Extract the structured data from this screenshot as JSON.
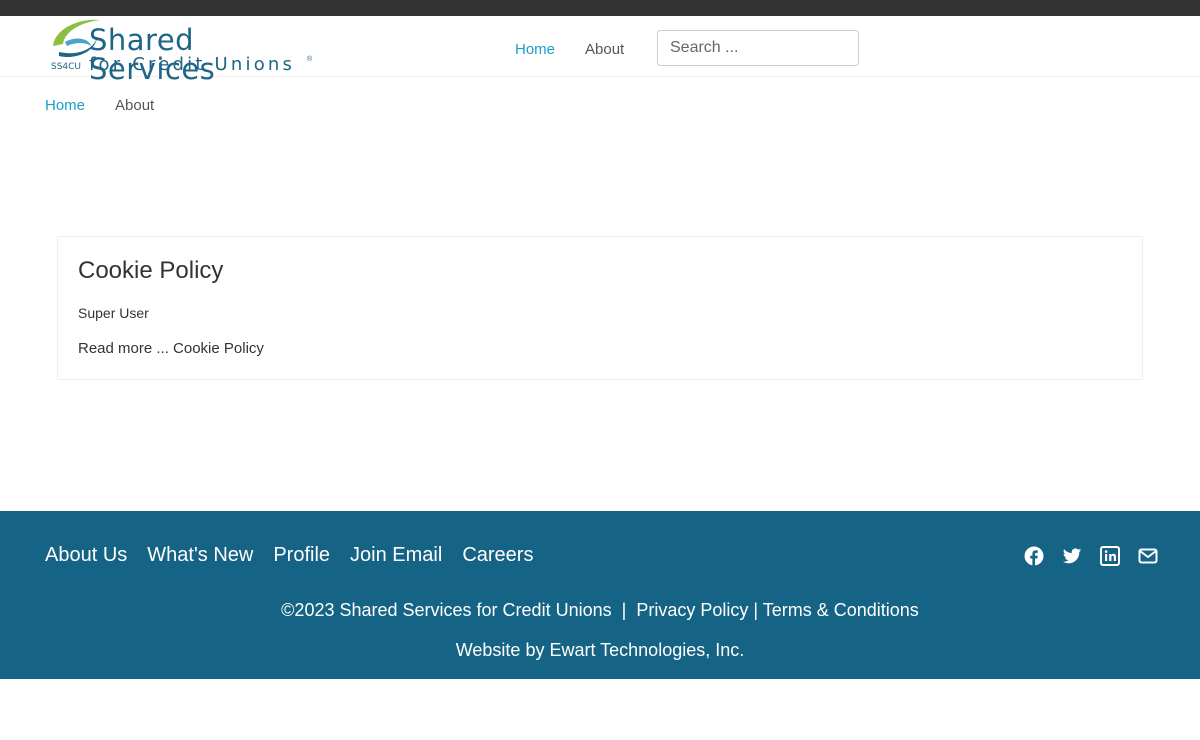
{
  "header": {
    "logo": {
      "main": "Shared Services",
      "sub": "for Credit Unions",
      "tag": "SS4CU",
      "reg": "®"
    },
    "nav": [
      {
        "label": "Home",
        "active": true
      },
      {
        "label": "About",
        "active": false
      }
    ],
    "search": {
      "placeholder": "Search ..."
    }
  },
  "breadcrumb": [
    {
      "label": "Home",
      "active": true
    },
    {
      "label": "About",
      "active": false
    }
  ],
  "article": {
    "title": "Cookie Policy",
    "author": "Super User",
    "read_more": "Read more ... Cookie Policy"
  },
  "footer": {
    "links": [
      "About Us",
      "What's New",
      "Profile",
      "Join Email",
      "Careers"
    ],
    "social": [
      "facebook-icon",
      "twitter-icon",
      "linkedin-icon",
      "email-icon"
    ],
    "copyright": "©2023 Shared Services for Credit Unions",
    "separator": "|",
    "privacy": "Privacy Policy",
    "separator2": "|",
    "terms": "Terms & Conditions",
    "credit": "Website by Ewart Technologies, Inc."
  },
  "colors": {
    "topbar": "#333333",
    "accent": "#1aa0c8",
    "footer_bg": "#156385",
    "brand": "#1e6587"
  }
}
